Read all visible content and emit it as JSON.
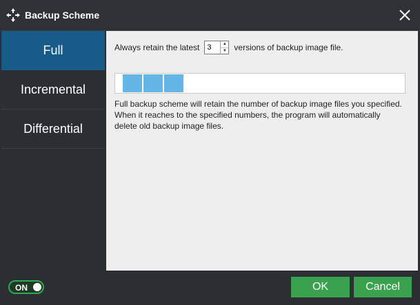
{
  "window": {
    "title": "Backup Scheme"
  },
  "icons": {
    "app": "backup-scheme-arrows-icon",
    "close": "close-icon"
  },
  "sidebar": {
    "items": [
      {
        "label": "Full",
        "active": true
      },
      {
        "label": "Incremental",
        "active": false
      },
      {
        "label": "Differential",
        "active": false
      }
    ]
  },
  "main": {
    "retain_prefix": "Always retain the latest",
    "retain_value": "3",
    "retain_suffix": "versions of backup image file.",
    "visual_segment_count": 3,
    "description": "Full backup scheme will retain the number of backup image files you specified. When it reaches to the specified numbers, the program will automatically delete old backup image files."
  },
  "footer": {
    "toggle_label": "ON",
    "toggle_on": true,
    "ok_label": "OK",
    "cancel_label": "Cancel"
  },
  "colors": {
    "accent_active": "#175b88",
    "segment": "#63b6e6",
    "button_green": "#3aa14e",
    "toggle_green": "#2fa84f"
  }
}
